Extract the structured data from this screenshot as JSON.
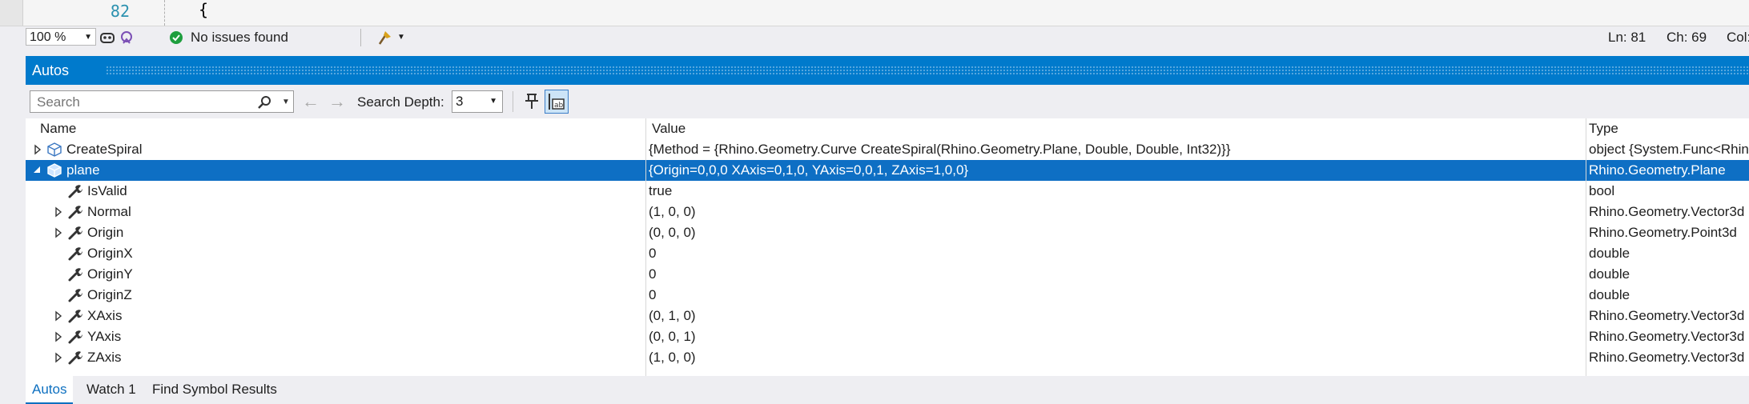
{
  "editor": {
    "line_number": "82",
    "code_text": "{"
  },
  "status_bar": {
    "zoom": "100 %",
    "issues": "No issues found",
    "ln": "Ln: 81",
    "ch": "Ch: 69",
    "col": "Col:"
  },
  "panel": {
    "title": "Autos",
    "search": {
      "placeholder": "Search"
    },
    "search_depth_label": "Search Depth:",
    "search_depth_value": "3"
  },
  "columns": {
    "name": "Name",
    "value": "Value",
    "type": "Type"
  },
  "rows": [
    {
      "name": "CreateSpiral",
      "value": "{Method = {Rhino.Geometry.Curve CreateSpiral(Rhino.Geometry.Plane, Double, Double, Int32)}}",
      "type": "object {System.Func<Rhino.G"
    },
    {
      "name": "plane",
      "value": "{Origin=0,0,0 XAxis=0,1,0, YAxis=0,0,1, ZAxis=1,0,0}",
      "type": "Rhino.Geometry.Plane"
    },
    {
      "name": "IsValid",
      "value": "true",
      "type": "bool"
    },
    {
      "name": "Normal",
      "value": "(1, 0, 0)",
      "type": "Rhino.Geometry.Vector3d"
    },
    {
      "name": "Origin",
      "value": "(0, 0, 0)",
      "type": "Rhino.Geometry.Point3d"
    },
    {
      "name": "OriginX",
      "value": "0",
      "type": "double"
    },
    {
      "name": "OriginY",
      "value": "0",
      "type": "double"
    },
    {
      "name": "OriginZ",
      "value": "0",
      "type": "double"
    },
    {
      "name": "XAxis",
      "value": "(0, 1, 0)",
      "type": "Rhino.Geometry.Vector3d"
    },
    {
      "name": "YAxis",
      "value": "(0, 0, 1)",
      "type": "Rhino.Geometry.Vector3d"
    },
    {
      "name": "ZAxis",
      "value": "(1, 0, 0)",
      "type": "Rhino.Geometry.Vector3d"
    }
  ],
  "bottom_tabs": [
    "Autos",
    "Watch 1",
    "Find Symbol Results"
  ],
  "colors": {
    "accent": "#007acc",
    "selection": "#0e6fc4",
    "success": "#1e9e3e"
  }
}
